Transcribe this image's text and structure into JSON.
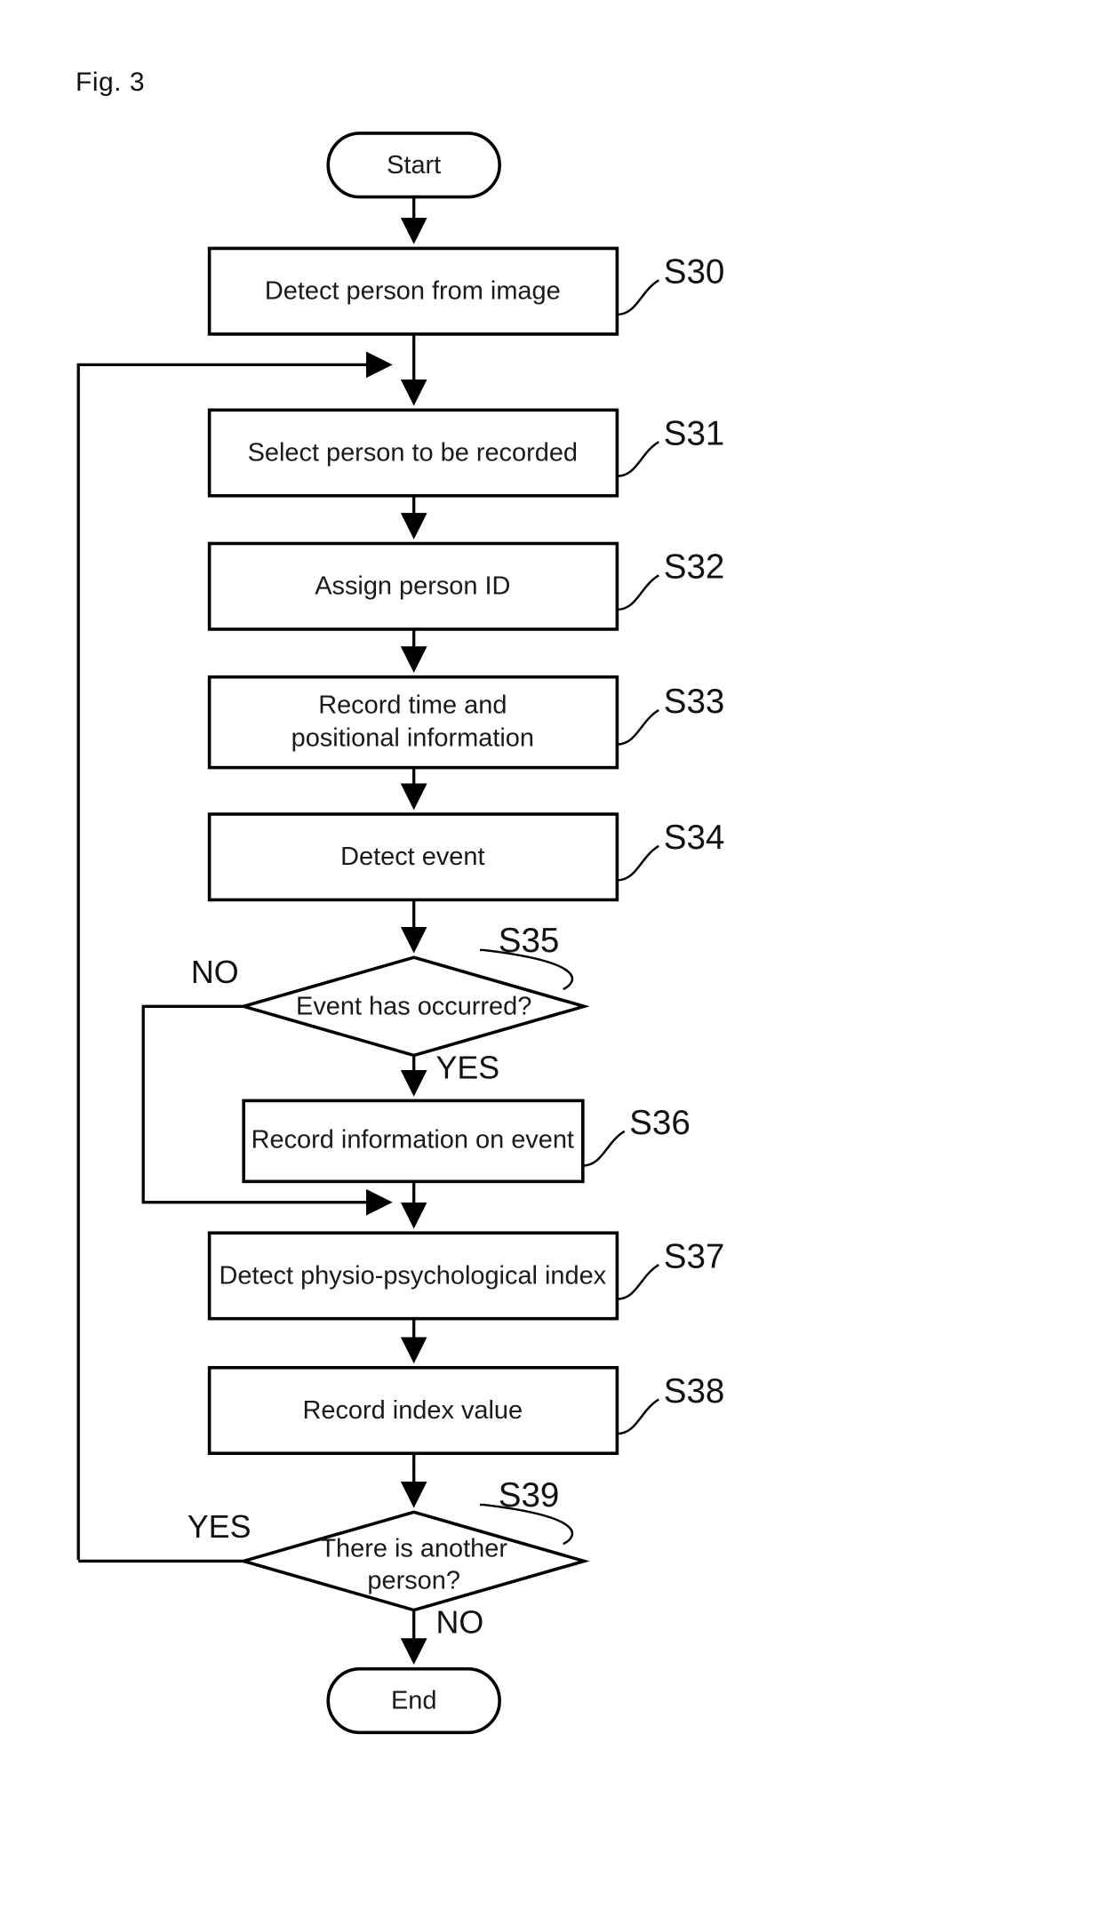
{
  "figure": {
    "title": "Fig. 3"
  },
  "flowchart": {
    "start_label": "Start",
    "end_label": "End",
    "steps": [
      {
        "id": "S30",
        "text": "Detect person from image",
        "label": "S30"
      },
      {
        "id": "S31",
        "text": "Select person to be recorded",
        "label": "S31"
      },
      {
        "id": "S32",
        "text": "Assign person ID",
        "label": "S32"
      },
      {
        "id": "S33",
        "text_line1": "Record time and",
        "text_line2": "positional information",
        "label": "S33"
      },
      {
        "id": "S34",
        "text": "Detect event",
        "label": "S34"
      },
      {
        "id": "S35",
        "text": "Event has occurred?",
        "label": "S35"
      },
      {
        "id": "S36",
        "text": "Record information on event",
        "label": "S36"
      },
      {
        "id": "S37",
        "text": "Detect physio-psychological index",
        "label": "S37"
      },
      {
        "id": "S38",
        "text": "Record index value",
        "label": "S38"
      },
      {
        "id": "S39",
        "text_line1": "There is another",
        "text_line2": "person?",
        "label": "S39"
      }
    ],
    "branch_labels": {
      "s35_no": "NO",
      "s35_yes": "YES",
      "s39_yes": "YES",
      "s39_no": "NO"
    },
    "colors": {
      "stroke": "#000000",
      "fill": "#ffffff",
      "text": "#1a1a1a"
    }
  }
}
